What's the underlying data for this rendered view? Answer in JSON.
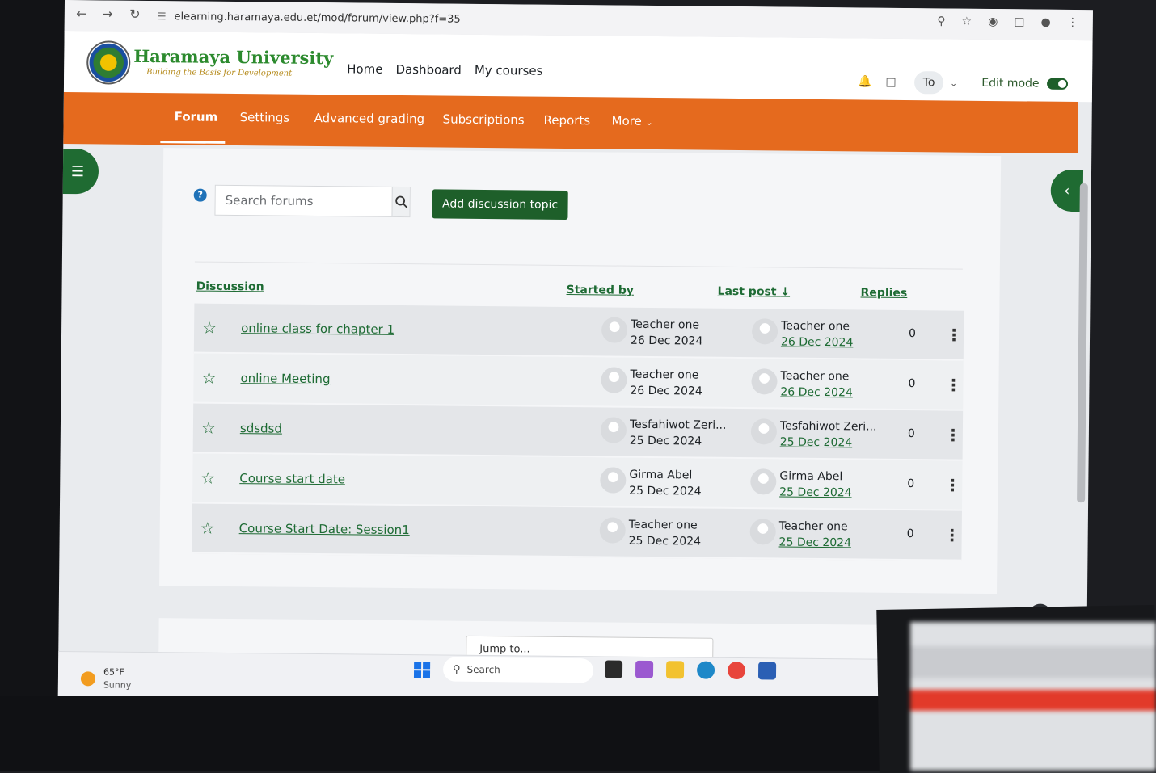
{
  "browser": {
    "url": "elearning.haramaya.edu.et/mod/forum/view.php?f=35",
    "back_icon": "arrow-left-icon",
    "forward_icon": "arrow-right-icon",
    "reload_icon": "reload-icon"
  },
  "site": {
    "name": "Haramaya University",
    "tagline": "Building the Basis for Development",
    "nav": [
      "Home",
      "Dashboard",
      "My courses"
    ],
    "user_initials": "To",
    "edit_mode_label": "Edit mode",
    "edit_mode_on": true
  },
  "tabs": {
    "forum": "Forum",
    "settings": "Settings",
    "advanced_grading": "Advanced grading",
    "subscriptions": "Subscriptions",
    "reports": "Reports",
    "more": "More"
  },
  "forum": {
    "search_placeholder": "Search forums",
    "add_button": "Add discussion topic",
    "columns": {
      "discussion": "Discussion",
      "started_by": "Started by",
      "last_post": "Last post",
      "replies": "Replies"
    },
    "discussions": [
      {
        "title": "online class for chapter 1",
        "started_by": "Teacher one",
        "started_date": "26 Dec 2024",
        "last_by": "Teacher one",
        "last_date": "26 Dec 2024",
        "replies": "0"
      },
      {
        "title": "online Meeting",
        "started_by": "Teacher one",
        "started_date": "26 Dec 2024",
        "last_by": "Teacher one",
        "last_date": "26 Dec 2024",
        "replies": "0"
      },
      {
        "title": "sdsdsd",
        "started_by": "Tesfahiwot Zeri...",
        "started_date": "25 Dec 2024",
        "last_by": "Tesfahiwot Zeri...",
        "last_date": "25 Dec 2024",
        "replies": "0"
      },
      {
        "title": "Course start date",
        "started_by": "Girma Abel",
        "started_date": "25 Dec 2024",
        "last_by": "Girma Abel",
        "last_date": "25 Dec 2024",
        "replies": "0"
      },
      {
        "title": "Course Start Date: Session1",
        "started_by": "Teacher one",
        "started_date": "25 Dec 2024",
        "last_by": "Teacher one",
        "last_date": "25 Dec 2024",
        "replies": "0"
      }
    ],
    "jump_to": "Jump to..."
  },
  "taskbar": {
    "temperature": "65°F",
    "condition": "Sunny",
    "search_label": "Search"
  },
  "colors": {
    "brand_orange": "#e56a1e",
    "brand_green": "#1e5f2a",
    "link_green": "#1e6b34"
  }
}
